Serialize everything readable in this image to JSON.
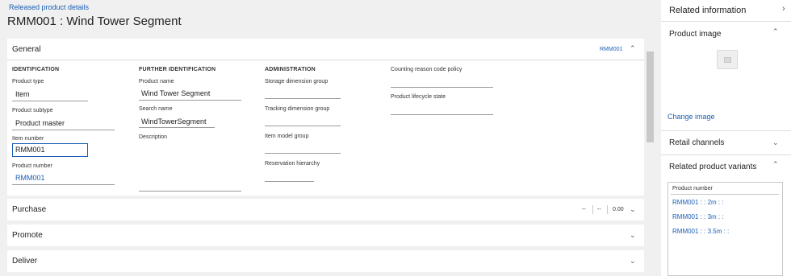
{
  "breadcrumb": "Released product details",
  "title": "RMM001 : Wind Tower Segment",
  "general": {
    "title": "General",
    "summary": "RMM001",
    "groups": {
      "identification": {
        "title": "IDENTIFICATION",
        "product_type_label": "Product type",
        "product_type_value": "Item",
        "product_subtype_label": "Product subtype",
        "product_subtype_value": "Product master",
        "item_number_label": "Item number",
        "item_number_value": "RMM001",
        "product_number_label": "Product number",
        "product_number_value": "RMM001"
      },
      "further": {
        "title": "FURTHER IDENTIFICATION",
        "product_name_label": "Product name",
        "product_name_value": "Wind Tower Segment",
        "search_name_label": "Search name",
        "search_name_value": "WindTowerSegment",
        "description_label": "Description"
      },
      "administration": {
        "title": "ADMINISTRATION",
        "storage_label": "Storage dimension group",
        "tracking_label": "Tracking dimension group",
        "item_model_label": "Item model group",
        "reservation_label": "Reservation hierarchy"
      },
      "other": {
        "counting_label": "Counting reason code policy",
        "lifecycle_label": "Product lifecycle state"
      }
    }
  },
  "purchase": {
    "title": "Purchase",
    "summary": [
      "--",
      "--",
      "0.00"
    ]
  },
  "promote": {
    "title": "Promote"
  },
  "deliver": {
    "title": "Deliver"
  },
  "related": {
    "title": "Related information",
    "product_image_title": "Product image",
    "change_image": "Change image",
    "retail_channels_title": "Retail channels",
    "variants_title": "Related product variants",
    "variants_header": "Product number",
    "variants": [
      "RMM001 : : 2m : :",
      "RMM001 : : 3m : :",
      "RMM001 : : 3.5m : :"
    ]
  },
  "icons": {
    "collapse": "chevron-up-icon",
    "expand": "chevron-down-icon",
    "pane": "chevron-right-icon"
  }
}
